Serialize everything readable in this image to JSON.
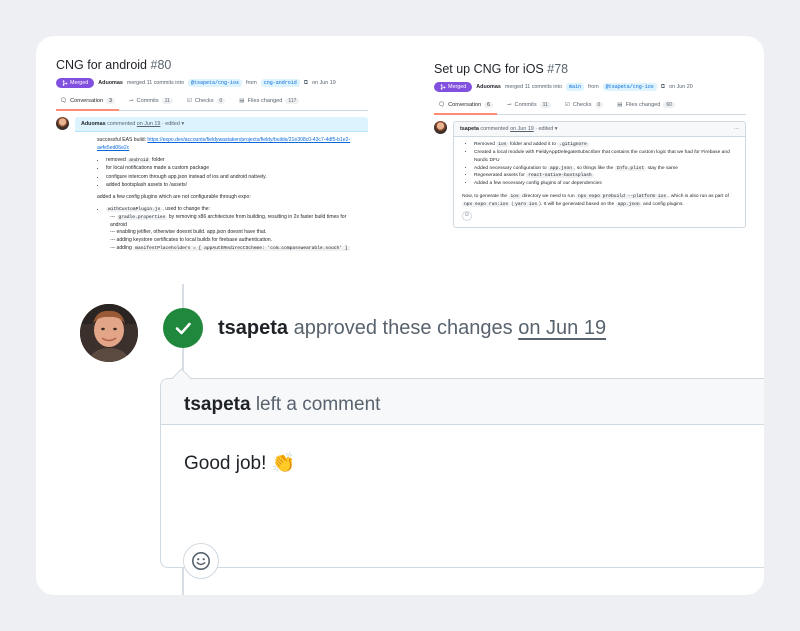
{
  "left_pr": {
    "title": "CNG for android",
    "number": "#80",
    "status": "Merged",
    "author": "Aduomas",
    "merge_text": "merged 11 commits into",
    "base_branch": "@tsapeta/cng-ios",
    "from_word": "from",
    "head_branch": "cng-android",
    "date": "on Jun 19",
    "tabs": [
      {
        "label": "Conversation",
        "count": "3"
      },
      {
        "label": "Commits",
        "count": "11"
      },
      {
        "label": "Checks",
        "count": "0"
      },
      {
        "label": "Files changed",
        "count": "117"
      }
    ],
    "comment": {
      "author": "Aduomas",
      "meta_prefix": "commented",
      "date": "on Jun 19",
      "edited": "· edited",
      "build_label": "successful EAS build:",
      "build_link": "https://expo.dev/accounts/fieldywastaken/projects/fieldy/builds/21e308c0-43c7-4df5-b1e2-aefe5ed06e2c",
      "bullets": [
        {
          "pre": "removed ",
          "code": "android",
          "post": " folder"
        },
        {
          "pre": "for local notifications made a custom package",
          "code": "",
          "post": ""
        },
        {
          "pre": "configure intercom through app.json instead of ios and android natively.",
          "code": "",
          "post": ""
        },
        {
          "pre": "added bootsplash assets to /assets/",
          "code": "",
          "post": ""
        }
      ],
      "config_intro": "added a few config plugins which are not configurable through expo:",
      "plugin_code": "withCustomPlugin.js",
      "plugin_text": ", used to change the:",
      "sub_lines": [
        {
          "pre": "--- ",
          "code": "gradle.properties",
          "post": " by removing x86 architecture from building, resulting in 2x faster build times for android"
        },
        {
          "pre": "--- enabling jetifier, otherwise doesnt build. app.json doesnt have that.",
          "code": "",
          "post": ""
        },
        {
          "pre": "--- adding keystore certificates to local builds for firebase authentication.",
          "code": "",
          "post": ""
        },
        {
          "pre": "--- adding ",
          "code": "manifestPlaceholders = [ appAuthRedirectScheme: 'com.compasswearable.souch' ]",
          "post": ""
        }
      ]
    }
  },
  "right_pr": {
    "title": "Set up CNG for iOS",
    "number": "#78",
    "status": "Merged",
    "author": "Aduomas",
    "merge_text": "merged 11 commits into",
    "base_branch": "main",
    "from_word": "from",
    "head_branch": "@tsapeta/cng-ios",
    "date": "on Jun 20",
    "tabs": [
      {
        "label": "Conversation",
        "count": "6"
      },
      {
        "label": "Commits",
        "count": "11"
      },
      {
        "label": "Checks",
        "count": "0"
      },
      {
        "label": "Files changed",
        "count": "60"
      }
    ],
    "comment": {
      "author": "tsapeta",
      "meta_prefix": "commented",
      "date": "on Jun 19",
      "edited": "· edited",
      "menu": "···",
      "bullets": [
        {
          "pre": "Removed ",
          "code": "ios",
          "post": " folder and added it to ",
          "code2": ".gitignore",
          "post2": ""
        },
        {
          "pre": "Created a local module with FieldyAppDelegateSubscriber that contains the custom logic that we had for Firebase and Nordic DFU",
          "code": "",
          "post": "",
          "code2": "",
          "post2": ""
        },
        {
          "pre": "Added necessary configuration to ",
          "code": "app.json",
          "post": ", so things like the ",
          "code2": "Info.plist",
          "post2": " stay the same"
        },
        {
          "pre": "Regenerated assets for ",
          "code": "react-native-bootsplash",
          "post": "",
          "code2": "",
          "post2": ""
        },
        {
          "pre": "Added a few necessary config plugins of our dependencies",
          "code": "",
          "post": "",
          "code2": "",
          "post2": ""
        }
      ],
      "para_1": "Now, to generate the ",
      "para_code1": "ios",
      "para_2": " directory we need to run ",
      "para_code2": "npx expo prebuild --platform ios",
      "para_3": ", which is also run as part of ",
      "para_code3": "npx expo run:ios",
      "para_4": " (",
      "para_code4": "yarn ios",
      "para_5": "). It will be generated based on the ",
      "para_code5": "app.json",
      "para_6": " and config plugins."
    }
  },
  "review": {
    "author": "tsapeta",
    "action": "approved these changes",
    "date": "on Jun 19",
    "comment_author": "tsapeta",
    "comment_action": "left a comment",
    "comment_body": "Good job! 👏"
  },
  "colors": {
    "merged": "#8250df",
    "approve": "#1f883d",
    "link": "#0969da"
  },
  "icons": [
    "merge-icon",
    "check-icon",
    "smiley-icon",
    "conversation-icon",
    "commits-icon",
    "checks-icon",
    "files-icon",
    "copy-icon"
  ]
}
